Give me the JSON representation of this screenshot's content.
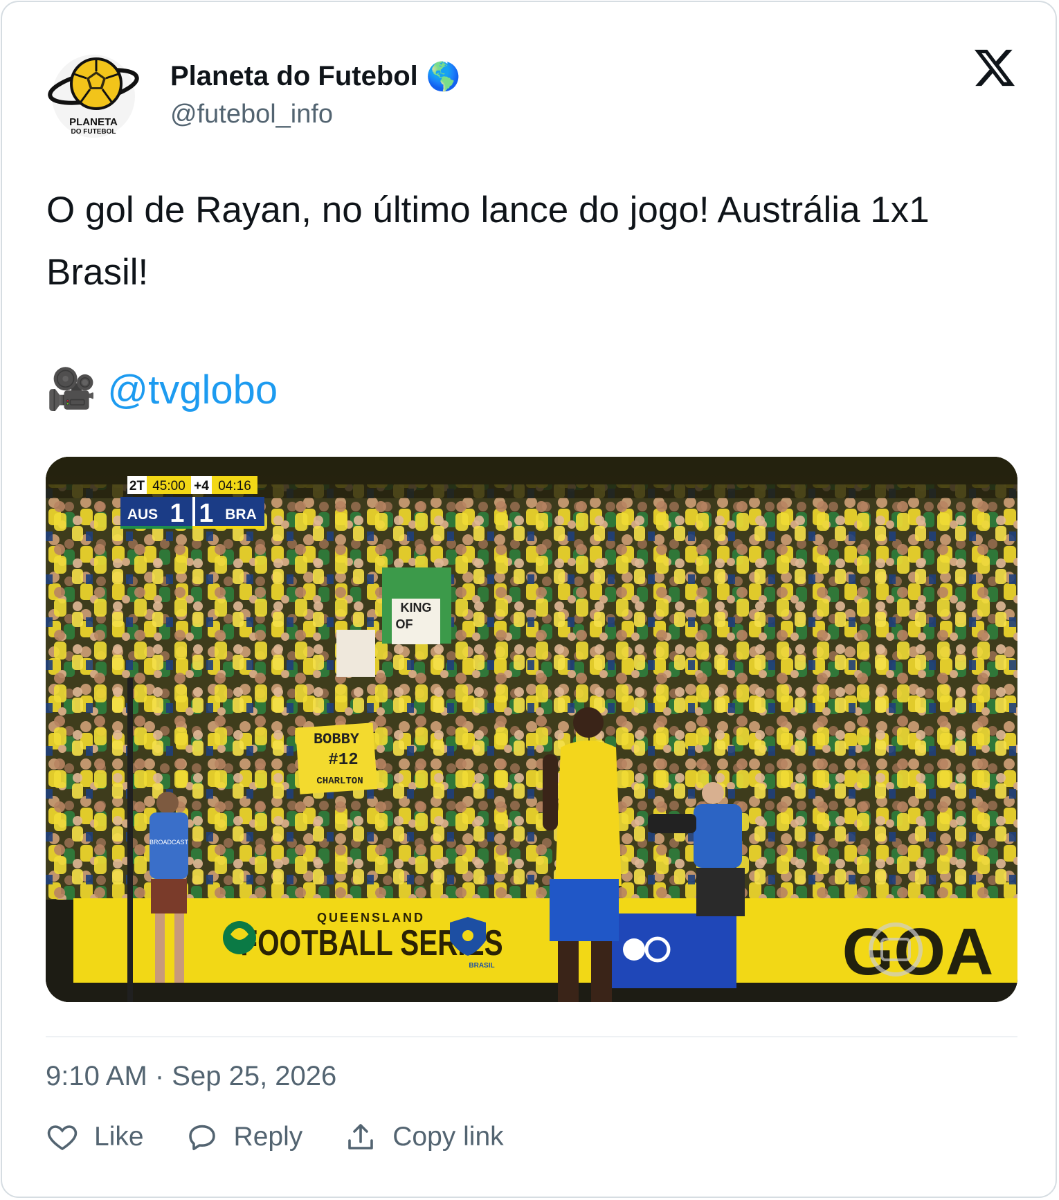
{
  "author": {
    "name": "Planeta do Futebol",
    "verified_emoji": "🌎",
    "handle": "@futebol_info",
    "avatar_text_line1": "PLANETA",
    "avatar_text_line2": "DO FUTEBOL"
  },
  "post": {
    "text": "O gol de Rayan, no último lance do jogo! Austrália 1x1 Brasil!",
    "credit_emoji": "🎥",
    "credit_mention": "@tvglobo"
  },
  "media": {
    "scoreboard": {
      "period": "2T",
      "time": "45:00",
      "added": "+4",
      "extra_time": "04:16",
      "home_team": "AUS",
      "home_score": "1",
      "away_score": "1",
      "away_team": "BRA"
    },
    "sign_bobby": [
      "BOBBY",
      "#12",
      "CHARLTON"
    ],
    "sign_king": [
      "KING",
      "OF"
    ],
    "banner_top": "QUEENSLAND",
    "banner_main": "FOOTBALL SERIES",
    "banner_brasil": "BRASIL",
    "banner_goal": "GOA",
    "vest_text": "BROADCAST"
  },
  "meta": {
    "timestamp": "9:10 AM · Sep 25, 2026"
  },
  "actions": {
    "like": "Like",
    "reply": "Reply",
    "copy_link": "Copy link"
  },
  "colors": {
    "link": "#1d9bf0",
    "secondary_text": "#536471",
    "border": "#d6dde2",
    "brazil_yellow": "#f2d816",
    "brazil_blue": "#1d4fa3"
  }
}
